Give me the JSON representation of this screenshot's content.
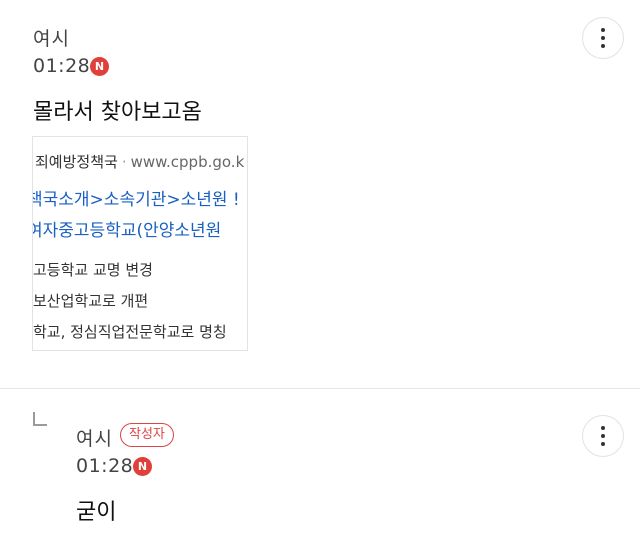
{
  "comments": [
    {
      "author": "여시",
      "time": "01:28",
      "new_badge": "N",
      "text": "몰라서 찾아보고옴",
      "thumbnail": {
        "source_name": "죄예방정책국",
        "source_url": "www.cppb.go.k",
        "breadcrumb": "책국소개>소속기관>소년원 !",
        "title": "여자중고등학교(안양소년원",
        "snippet_lines": [
          "고등학교 교명 변경",
          "보산업학교로 개편",
          "학교, 정심직업전문학교로 명칭"
        ]
      }
    },
    {
      "author": "여시",
      "author_badge": "작성자",
      "time": "01:28",
      "new_badge": "N",
      "text": "굳이"
    }
  ],
  "colors": {
    "new_badge": "#e0403a",
    "author_badge": "#dd4444",
    "link": "#1a5fc4"
  }
}
